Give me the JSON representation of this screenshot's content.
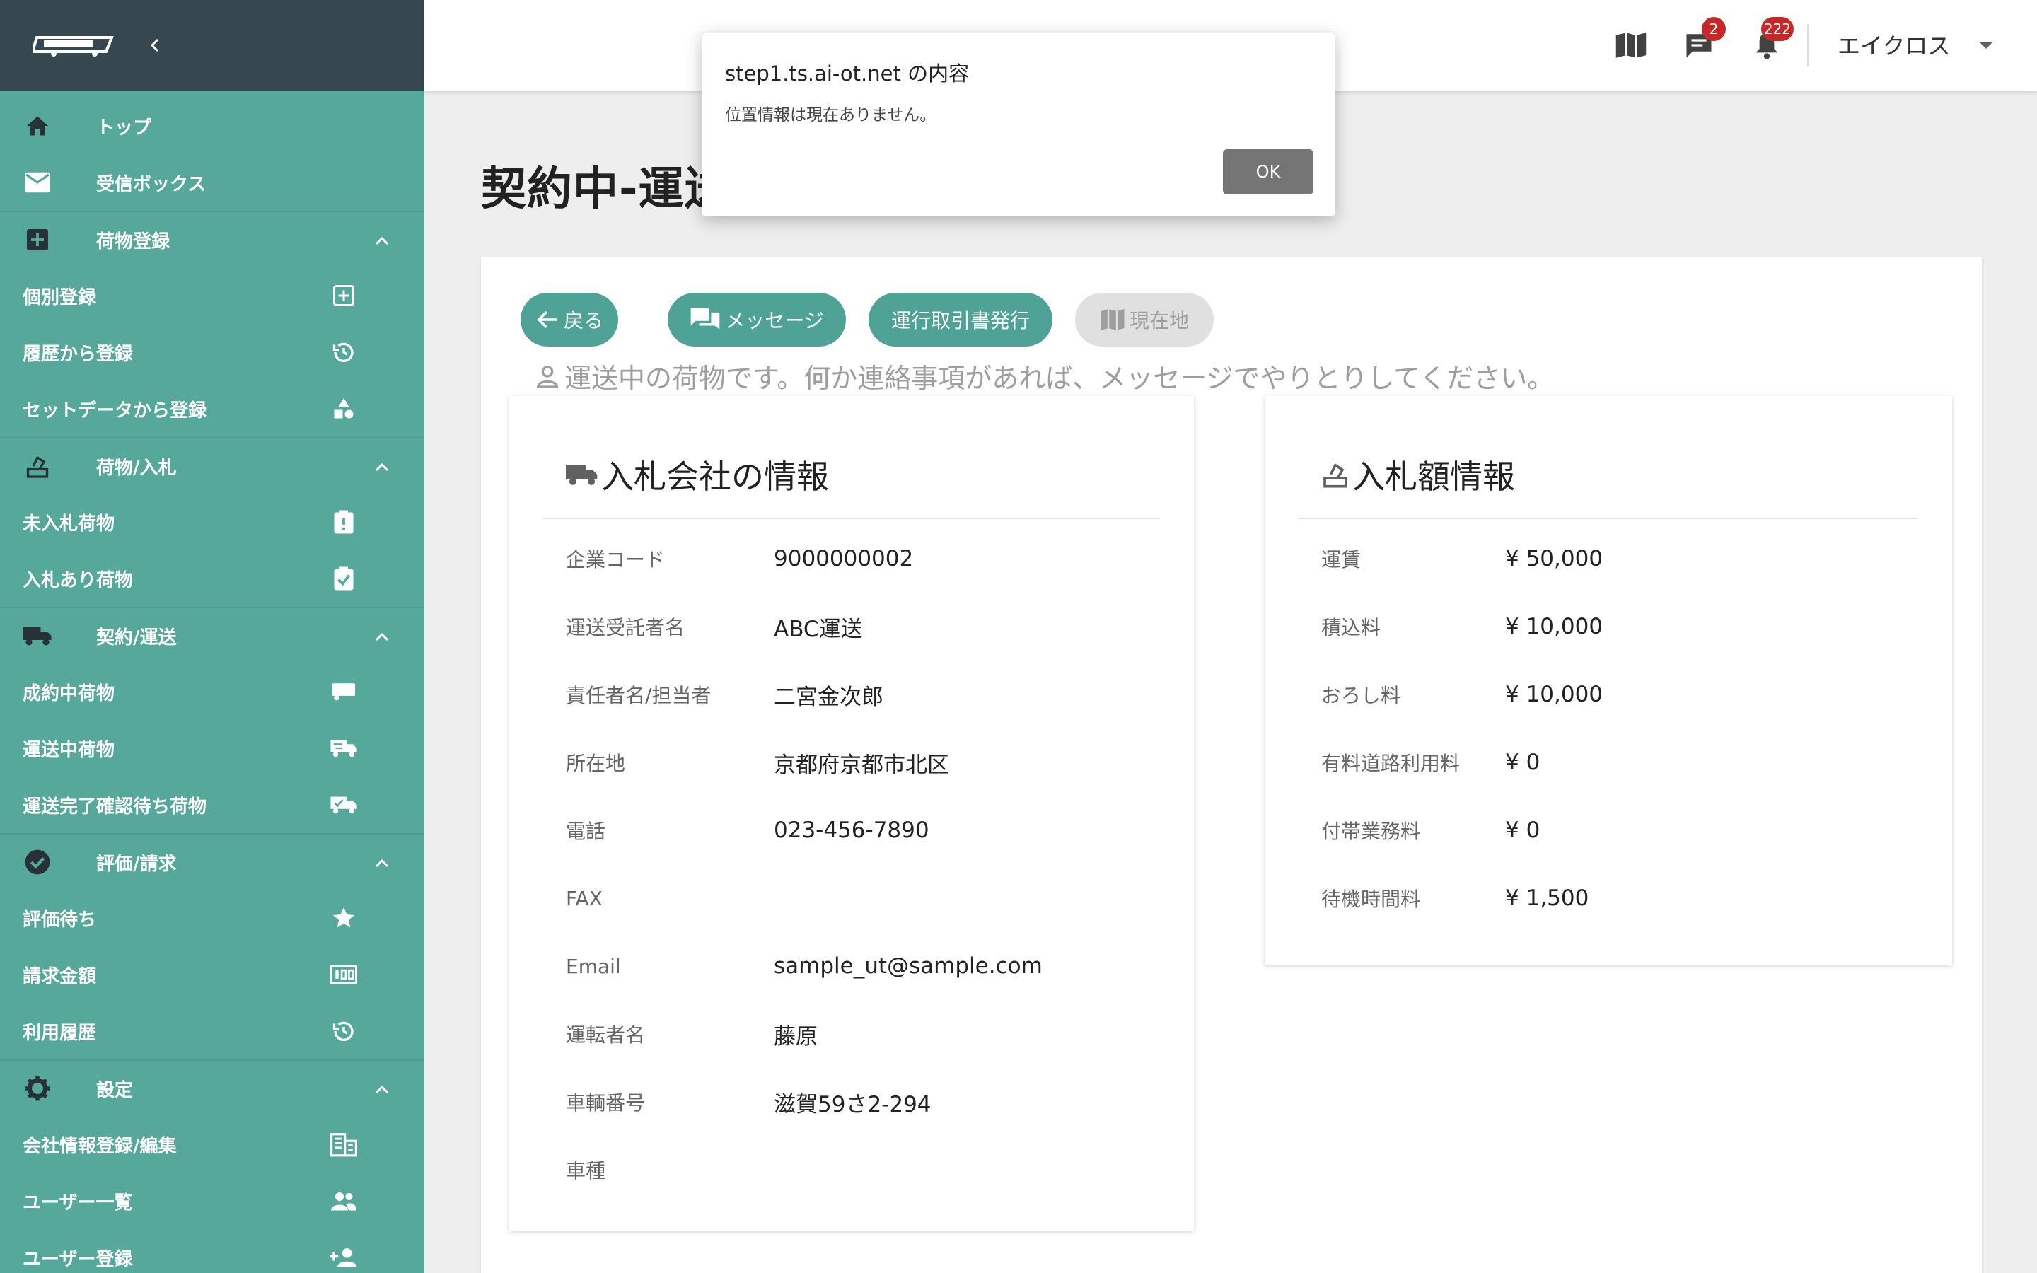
{
  "colors": {
    "sidebar": "#55a89a",
    "sidebar_header": "#37474f",
    "accent": "#4fa396",
    "badge": "#c62828"
  },
  "sidebar": {
    "top_items": [
      {
        "label": "トップ",
        "icon": "home-icon"
      },
      {
        "label": "受信ボックス",
        "icon": "mail-icon"
      }
    ],
    "sections": [
      {
        "label": "荷物登録",
        "icon": "add-box-icon",
        "items": [
          {
            "label": "個別登録",
            "icon": "add-square-icon"
          },
          {
            "label": "履歴から登録",
            "icon": "history-icon"
          },
          {
            "label": "セットデータから登録",
            "icon": "shapes-icon"
          }
        ]
      },
      {
        "label": "荷物/入札",
        "icon": "vote-icon",
        "items": [
          {
            "label": "未入札荷物",
            "icon": "clipboard-alert-icon"
          },
          {
            "label": "入札あり荷物",
            "icon": "clipboard-check-icon"
          }
        ]
      },
      {
        "label": "契約/運送",
        "icon": "truck-icon",
        "items": [
          {
            "label": "成約中荷物",
            "icon": "truck-icon"
          },
          {
            "label": "運送中荷物",
            "icon": "truck-fast-icon"
          },
          {
            "label": "運送完了確認待ち荷物",
            "icon": "truck-check-icon"
          }
        ]
      },
      {
        "label": "評価/請求",
        "icon": "check-circle-icon",
        "items": [
          {
            "label": "評価待ち",
            "icon": "star-icon"
          },
          {
            "label": "請求金額",
            "icon": "money-icon"
          },
          {
            "label": "利用履歴",
            "icon": "history-icon"
          }
        ]
      },
      {
        "label": "設定",
        "icon": "gear-icon",
        "items": [
          {
            "label": "会社情報登録/編集",
            "icon": "building-icon"
          },
          {
            "label": "ユーザー一覧",
            "icon": "users-icon"
          },
          {
            "label": "ユーザー登録",
            "icon": "user-add-icon"
          }
        ]
      }
    ]
  },
  "header": {
    "messages_badge": "2",
    "notifications_badge": "222",
    "user_name": "エイクロス"
  },
  "page": {
    "title": "契約中-運送",
    "buttons": {
      "back": "戻る",
      "message": "メッセージ",
      "issue": "運行取引書発行",
      "location": "現在地"
    },
    "notice": "運送中の荷物です。何か連絡事項があれば、メッセージでやりとりしてください。"
  },
  "company_card": {
    "title": "入札会社の情報",
    "rows": [
      {
        "k": "企業コード",
        "v": "9000000002"
      },
      {
        "k": "運送受託者名",
        "v": "ABC運送"
      },
      {
        "k": "責任者名/担当者",
        "v": "二宮金次郎"
      },
      {
        "k": "所在地",
        "v": "京都府京都市北区"
      },
      {
        "k": "電話",
        "v": "023-456-7890"
      },
      {
        "k": "FAX",
        "v": ""
      },
      {
        "k": "Email",
        "v": "sample_ut@sample.com"
      },
      {
        "k": "運転者名",
        "v": "藤原"
      },
      {
        "k": "車輌番号",
        "v": "滋賀59さ2-294"
      },
      {
        "k": "車種",
        "v": ""
      }
    ]
  },
  "bid_card": {
    "title": "入札額情報",
    "rows": [
      {
        "k": "運賃",
        "v": "¥ 50,000"
      },
      {
        "k": "積込料",
        "v": "¥ 10,000"
      },
      {
        "k": "おろし料",
        "v": "¥ 10,000"
      },
      {
        "k": "有料道路利用料",
        "v": "¥ 0"
      },
      {
        "k": "付帯業務料",
        "v": "¥ 0"
      },
      {
        "k": "待機時間料",
        "v": "¥ 1,500"
      }
    ]
  },
  "dialog": {
    "title": "step1.ts.ai-ot.net の内容",
    "message": "位置情報は現在ありません。",
    "ok": "OK"
  }
}
